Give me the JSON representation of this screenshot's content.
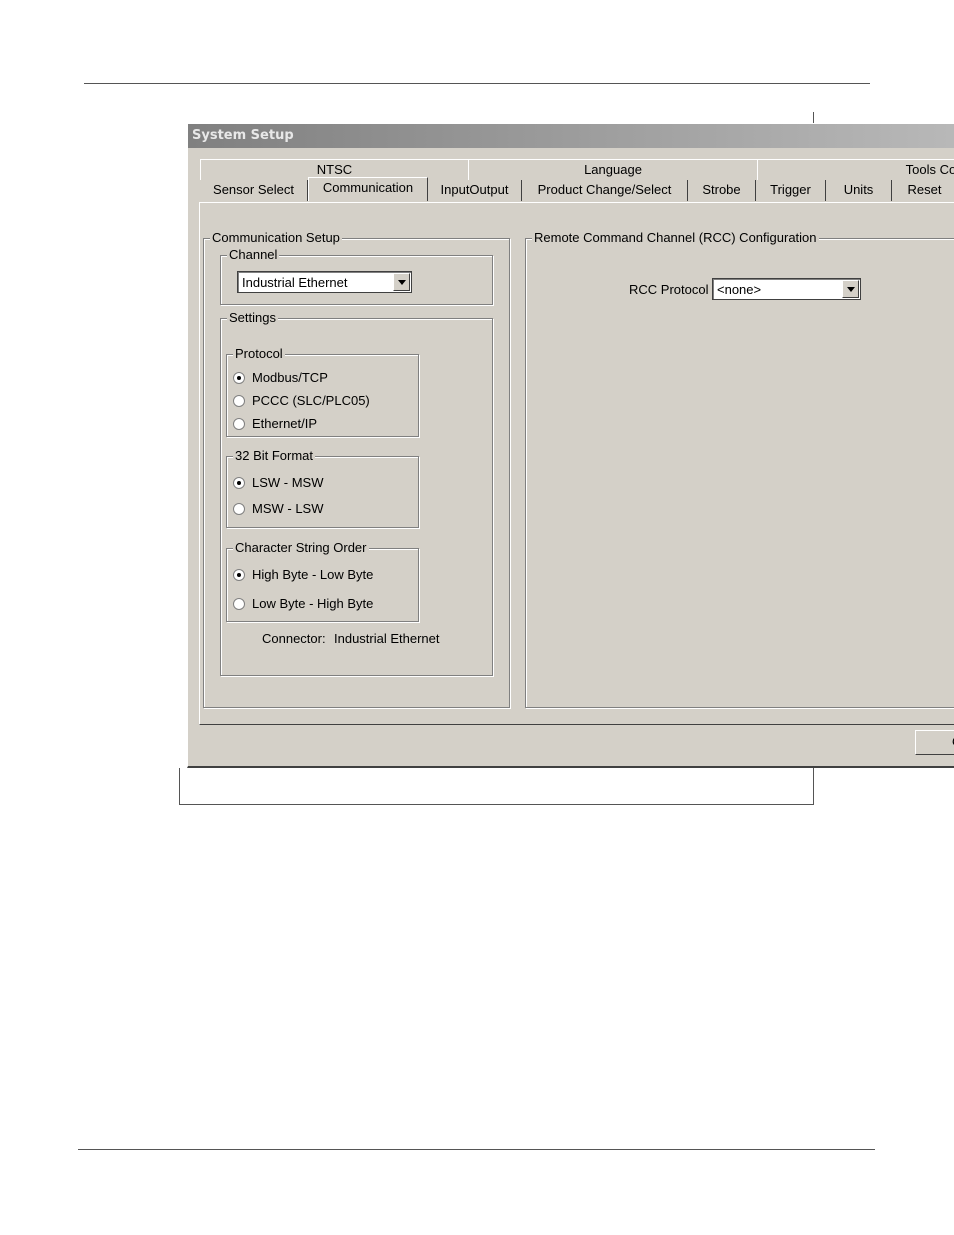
{
  "window": {
    "title": "System Setup"
  },
  "tabs_row1": [
    "NTSC",
    "Language",
    "Tools Configura"
  ],
  "tabs_row2": [
    "Sensor Select",
    "Communication",
    "InputOutput",
    "Product Change/Select",
    "Strobe",
    "Trigger",
    "Units",
    "Reset"
  ],
  "active_tab": "Communication",
  "communication_setup": {
    "title": "Communication Setup",
    "channel": {
      "label": "Channel",
      "value": "Industrial Ethernet"
    },
    "settings": {
      "label": "Settings",
      "protocol": {
        "label": "Protocol",
        "options": [
          "Modbus/TCP",
          "PCCC (SLC/PLC05)",
          "Ethernet/IP"
        ],
        "selected": "Modbus/TCP"
      },
      "bit_format": {
        "label": "32 Bit Format",
        "options": [
          "LSW - MSW",
          "MSW - LSW"
        ],
        "selected": "LSW - MSW"
      },
      "string_order": {
        "label": "Character String Order",
        "options": [
          "High Byte - Low Byte",
          "Low Byte - High Byte"
        ],
        "selected": "High Byte - Low Byte"
      },
      "connector_label": "Connector:",
      "connector_value": "Industrial Ethernet"
    }
  },
  "rcc": {
    "title": "Remote Command Channel (RCC) Configuration",
    "protocol_label": "RCC Protocol",
    "protocol_value": "<none>"
  },
  "ok_button_label": "O"
}
